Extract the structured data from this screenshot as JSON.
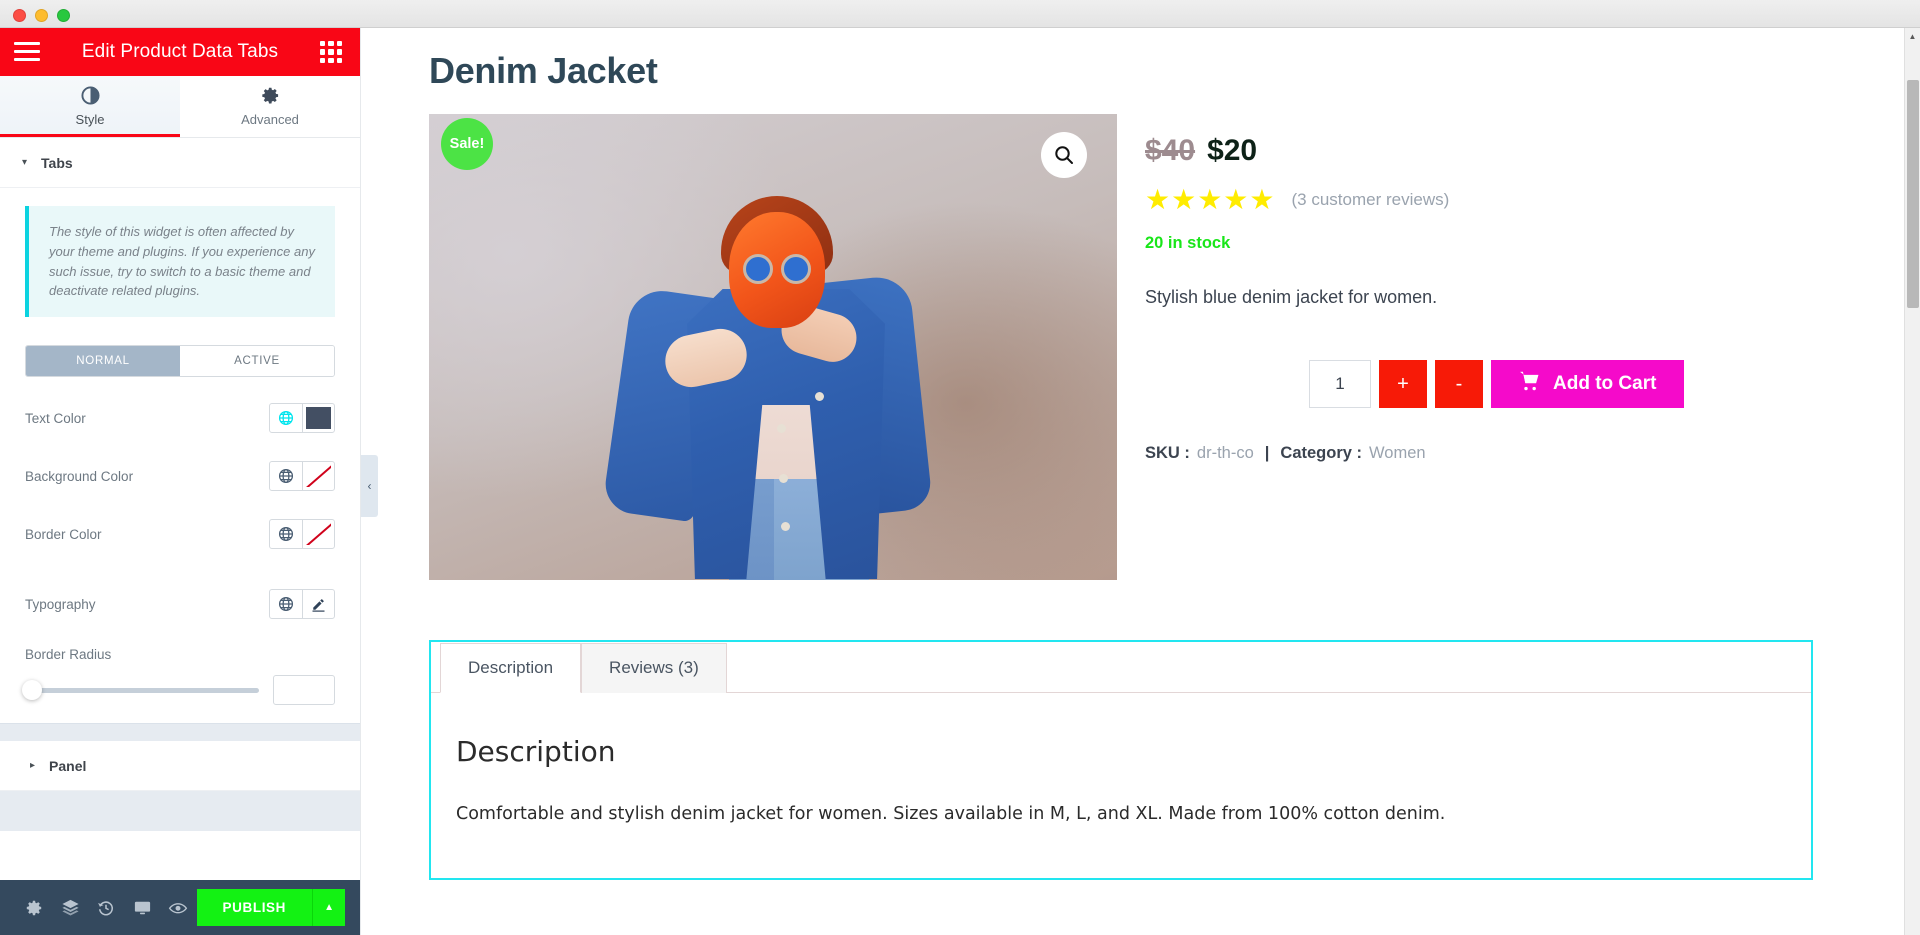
{
  "window": {
    "traffic_lights": [
      "close",
      "minimize",
      "maximize"
    ]
  },
  "panel": {
    "header": {
      "title": "Edit Product Data Tabs",
      "menu_icon": "hamburger-icon",
      "grid_icon": "grid-apps-icon"
    },
    "tabs": [
      {
        "label": "Style",
        "icon": "contrast-icon",
        "active": true
      },
      {
        "label": "Advanced",
        "icon": "gear-icon",
        "active": false
      }
    ],
    "sections": [
      {
        "label": "Tabs",
        "expanded": true,
        "caret": "▾"
      },
      {
        "label": "Panel",
        "expanded": false,
        "caret": "▸"
      }
    ],
    "notice": "The style of this widget is often affected by your theme and plugins. If you experience any such issue, try to switch to a basic theme and deactivate related plugins.",
    "state_tabs": [
      {
        "label": "NORMAL",
        "active": true
      },
      {
        "label": "ACTIVE",
        "active": false
      }
    ],
    "controls": [
      {
        "label": "Text Color",
        "globe_icon": "globe-icon",
        "globe_active": true,
        "swatch": "solid",
        "swatch_color": "#434f63"
      },
      {
        "label": "Background Color",
        "globe_icon": "globe-icon",
        "globe_active": false,
        "swatch": "empty",
        "swatch_color": "#ffffff"
      },
      {
        "label": "Border Color",
        "globe_icon": "globe-icon",
        "globe_active": false,
        "swatch": "empty",
        "swatch_color": "#ffffff"
      }
    ],
    "typography": {
      "label": "Typography",
      "globe_icon": "globe-icon",
      "edit_icon": "pencil-icon"
    },
    "border_radius": {
      "label": "Border Radius",
      "value": "",
      "slider_percent": 0
    },
    "bottom_bar": {
      "icons": [
        "gear-icon",
        "layers-icon",
        "history-icon",
        "responsive-monitor-icon",
        "preview-eye-icon"
      ],
      "publish_label": "PUBLISH",
      "publish_arrow": "▲",
      "publish_color": "#13f213"
    },
    "collapse_handle": "‹"
  },
  "preview": {
    "product_title": "Denim Jacket",
    "gallery": {
      "sale_badge": "Sale!",
      "zoom_icon": "magnifier-icon",
      "image_alt": "Woman in blue denim jacket and sunglasses"
    },
    "price": {
      "old": "$40",
      "new": "$20",
      "old_color": "#9d8b8f",
      "new_color": "#0e2218"
    },
    "rating": {
      "stars": "★★★★★",
      "star_count": 5,
      "star_color": "#ffec00",
      "reviews_label": "(3 customer reviews)"
    },
    "stock": "20 in stock",
    "stock_color": "#19e619",
    "short_description": "Stylish blue denim jacket for women.",
    "cart": {
      "quantity": "1",
      "plus_label": "+",
      "minus_label": "-",
      "add_label": "Add to Cart",
      "cart_icon": "shopping-cart-icon",
      "qty_button_color": "#f71a07",
      "add_button_color": "#f50aca"
    },
    "meta": {
      "sku_label": "SKU :",
      "sku_value": "dr-th-co",
      "divider": "|",
      "category_label": "Category :",
      "category_value": "Women"
    },
    "tabs_widget": {
      "tabs": [
        {
          "label": "Description",
          "active": true
        },
        {
          "label": "Reviews (3)",
          "active": false
        }
      ],
      "heading": "Description",
      "body": "Comfortable and stylish denim jacket for women. Sizes available in M, L, and XL. Made from 100% cotton denim.",
      "outline_color": "#22e6f0"
    }
  },
  "scrollbar": {
    "up_arrow": "▲",
    "down_arrow": "▼"
  }
}
